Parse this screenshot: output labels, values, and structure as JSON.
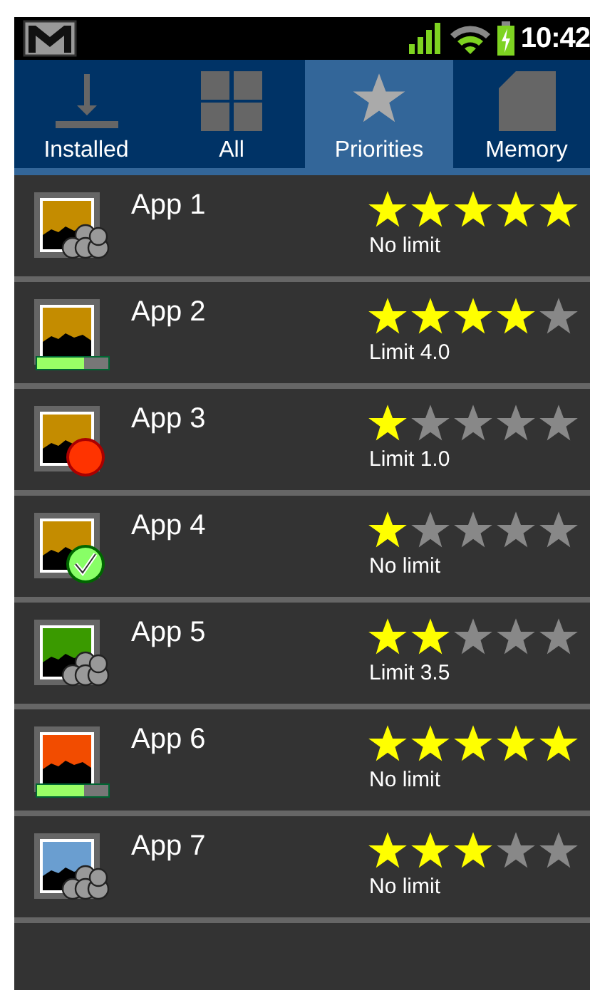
{
  "status_bar": {
    "time": "10:42"
  },
  "tabs": [
    {
      "label": "Installed",
      "selected": false
    },
    {
      "label": "All",
      "selected": false
    },
    {
      "label": "Priorities",
      "selected": true
    },
    {
      "label": "Memory",
      "selected": false
    }
  ],
  "apps": [
    {
      "name": "App 1",
      "color": "#c48c00",
      "kind": "cloud",
      "stars": 5,
      "limit": "No limit"
    },
    {
      "name": "App 2",
      "color": "#c48c00",
      "kind": "progress",
      "level": 0.66,
      "stars": 4,
      "limit": "Limit 4.0"
    },
    {
      "name": "App 3",
      "color": "#c48c00",
      "kind": "stopped",
      "stars": 1,
      "limit": "Limit 1.0"
    },
    {
      "name": "App 4",
      "color": "#c48c00",
      "kind": "ok",
      "stars": 1,
      "limit": "No limit"
    },
    {
      "name": "App 5",
      "color": "#3a9a00",
      "kind": "cloud",
      "stars": 2,
      "limit": "Limit 3.5"
    },
    {
      "name": "App 6",
      "color": "#f24c00",
      "kind": "progress",
      "level": 0.66,
      "stars": 5,
      "limit": "No limit"
    },
    {
      "name": "App 7",
      "color": "#6a9ed0",
      "kind": "cloud",
      "stars": 3,
      "limit": "No limit"
    }
  ]
}
